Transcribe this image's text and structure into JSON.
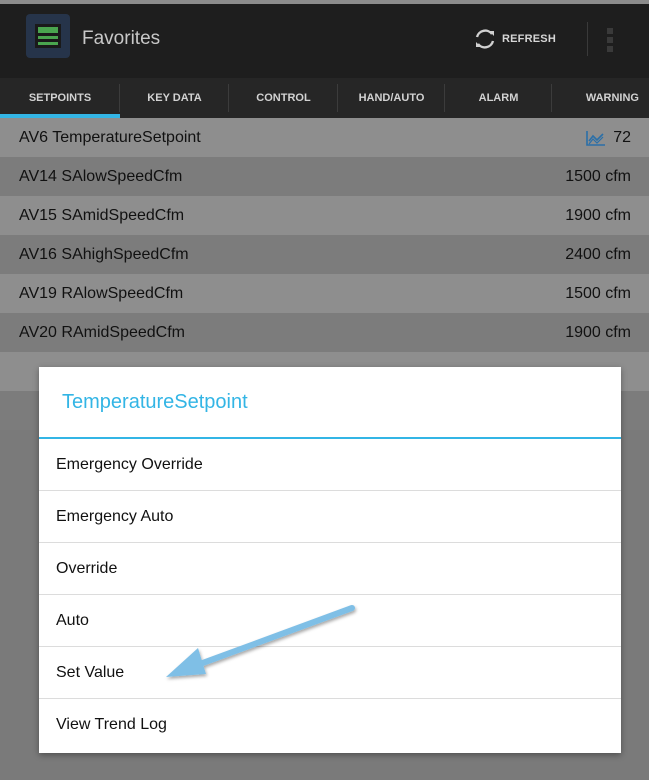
{
  "app": {
    "title": "Favorites",
    "refresh_label": "REFRESH"
  },
  "tabs": [
    {
      "label": "SETPOINTS",
      "active": true
    },
    {
      "label": "KEY DATA",
      "active": false
    },
    {
      "label": "CONTROL",
      "active": false
    },
    {
      "label": "HAND/AUTO",
      "active": false
    },
    {
      "label": "ALARM",
      "active": false
    },
    {
      "label": "WARNING",
      "active": false
    }
  ],
  "rows": [
    {
      "id": "AV6",
      "name": "TemperatureSetpoint",
      "value": "72",
      "unit": "",
      "has_trend_icon": true
    },
    {
      "id": "AV14",
      "name": "SAlowSpeedCfm",
      "value": "1500",
      "unit": "cfm"
    },
    {
      "id": "AV15",
      "name": "SAmidSpeedCfm",
      "value": "1900",
      "unit": "cfm"
    },
    {
      "id": "AV16",
      "name": "SAhighSpeedCfm",
      "value": "2400",
      "unit": "cfm"
    },
    {
      "id": "AV19",
      "name": "RAlowSpeedCfm",
      "value": "1500",
      "unit": "cfm"
    },
    {
      "id": "AV20",
      "name": "RAmidSpeedCfm",
      "value": "1900",
      "unit": "cfm"
    }
  ],
  "row_labels": [
    "AV6  TemperatureSetpoint",
    "AV14  SAlowSpeedCfm",
    "AV15  SAmidSpeedCfm",
    "AV16  SAhighSpeedCfm",
    "AV19  RAlowSpeedCfm",
    "AV20  RAmidSpeedCfm"
  ],
  "row_values": [
    "72",
    "1500 cfm",
    "1900 cfm",
    "2400 cfm",
    "1500 cfm",
    "1900 cfm"
  ],
  "dialog": {
    "title": "TemperatureSetpoint",
    "items": [
      "Emergency Override",
      "Emergency Auto",
      "Override",
      "Auto",
      "Set Value",
      "View Trend Log"
    ]
  },
  "colors": {
    "accent": "#33b5e5",
    "row_light": "#8e8e8e",
    "row_dark": "#7c7c7c",
    "arrow": "#7fbfe6"
  }
}
